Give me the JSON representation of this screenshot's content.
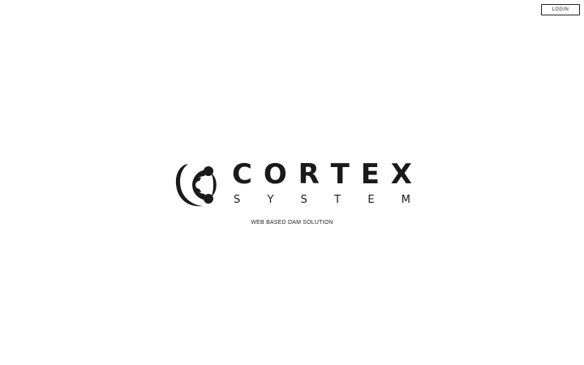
{
  "header": {
    "login_label": "LOGIN"
  },
  "brand": {
    "name": "CORTEX",
    "subtitle": "SYSTEM",
    "logo_icon": "cortex-c-orbit-logo",
    "tagline": "WEB BASED DAM SOLUTION"
  },
  "colors": {
    "background": "#ffffff",
    "text": "#1a1a1a"
  }
}
